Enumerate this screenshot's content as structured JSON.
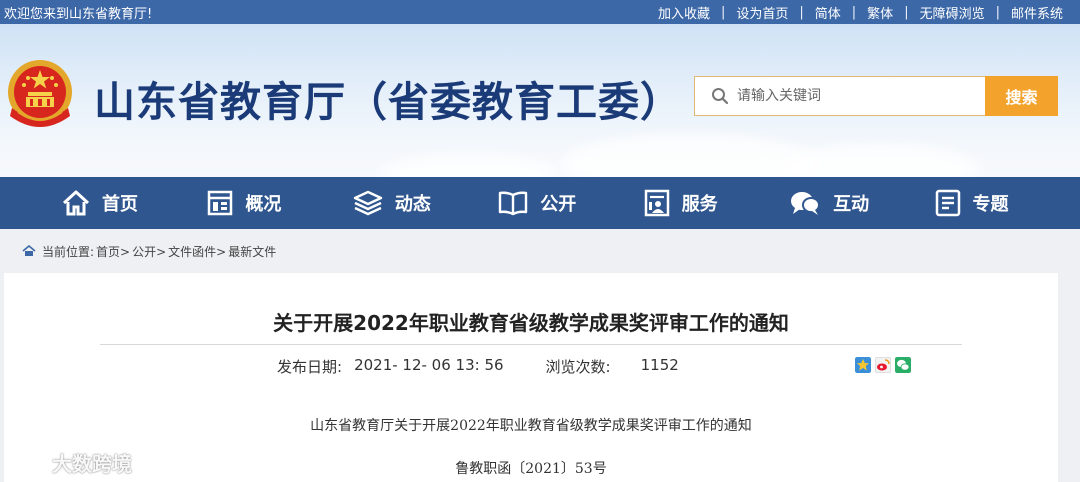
{
  "topbar": {
    "welcome": "欢迎您来到山东省教育厅!",
    "links": [
      "加入收藏",
      "设为首页",
      "简体",
      "繁体",
      "无障碍浏览",
      "邮件系统"
    ]
  },
  "header": {
    "site_title": "山东省教育厅（省委教育工委）",
    "search_placeholder": "请输入关键词",
    "search_button": "搜索"
  },
  "nav": {
    "items": [
      {
        "label": "首页",
        "icon": "home-icon"
      },
      {
        "label": "概况",
        "icon": "overview-icon"
      },
      {
        "label": "动态",
        "icon": "layers-icon"
      },
      {
        "label": "公开",
        "icon": "book-icon"
      },
      {
        "label": "服务",
        "icon": "service-icon"
      },
      {
        "label": "互动",
        "icon": "chat-icon"
      },
      {
        "label": "专题",
        "icon": "document-icon"
      }
    ]
  },
  "breadcrumb": {
    "prefix": "当前位置:",
    "items": [
      "首页>",
      "公开>",
      "文件函件>",
      "最新文件"
    ]
  },
  "article": {
    "title": "关于开展2022年职业教育省级教学成果奖评审工作的通知",
    "date_label": "发布日期:",
    "date_value": "2021- 12- 06 13: 56",
    "views_label": "浏览次数:",
    "views_value": "1152",
    "subtitle": "山东省教育厅关于开展2022年职业教育省级教学成果奖评审工作的通知",
    "doc_number": "鲁教职函〔2021〕53号"
  },
  "watermark": {
    "text": "大数跨境"
  },
  "colors": {
    "topbar": "#3d68a8",
    "nav": "#2f568f",
    "title": "#1b3b78",
    "search_button": "#f3a32c"
  }
}
